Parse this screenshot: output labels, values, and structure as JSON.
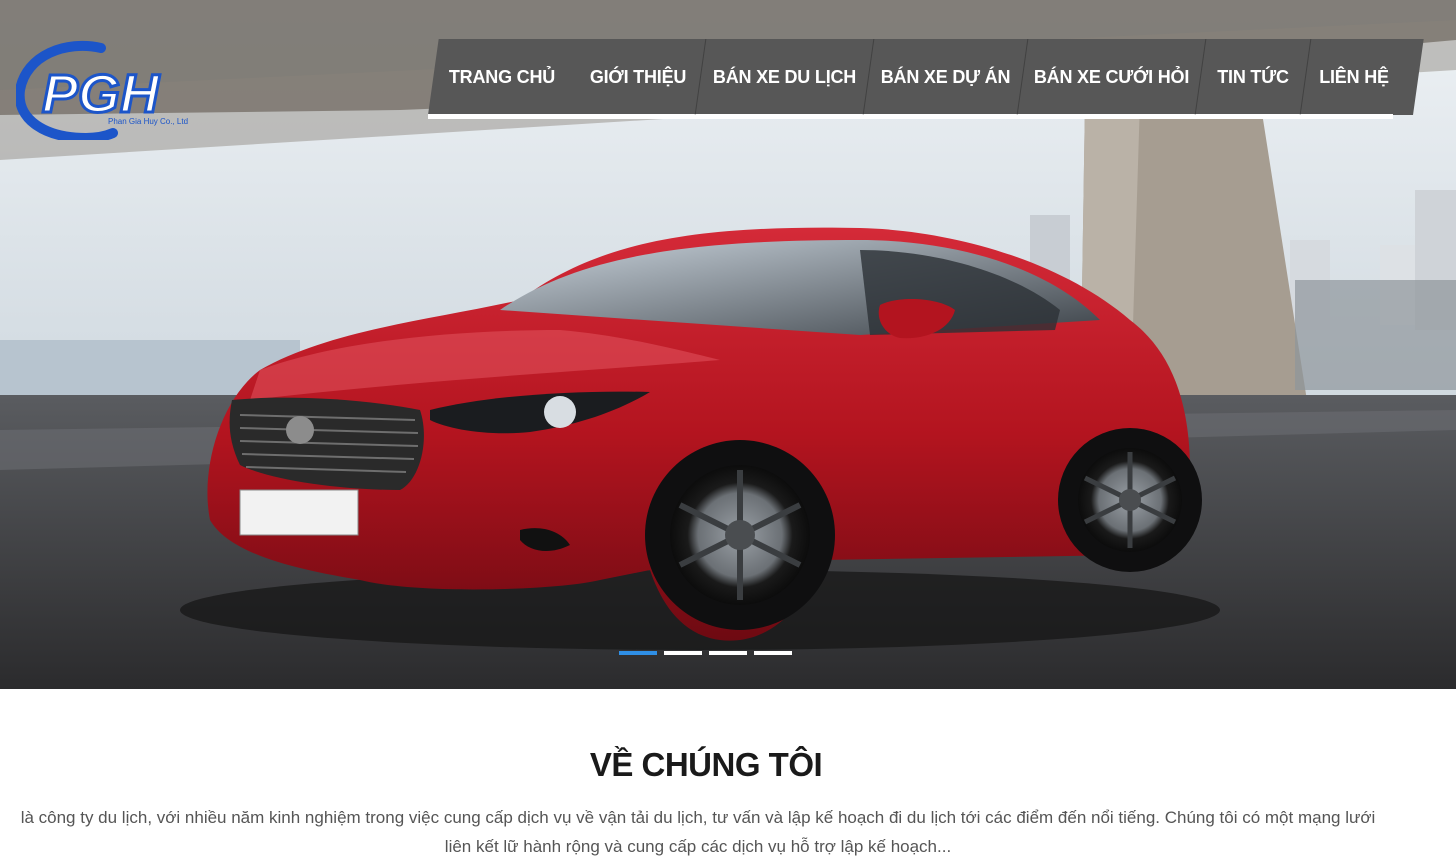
{
  "logo": {
    "text": "PGH",
    "tagline": "Phan Gia Huy Co., Ltd"
  },
  "nav": {
    "items": [
      {
        "label": "TRANG CHỦ",
        "active": true
      },
      {
        "label": "GIỚI THIỆU",
        "active": false
      },
      {
        "label": "BÁN XE DU LỊCH",
        "active": false
      },
      {
        "label": "BÁN XE DỰ ÁN",
        "active": false
      },
      {
        "label": "BÁN XE CƯỚI HỎI",
        "active": false
      },
      {
        "label": "TIN TỨC",
        "active": false
      },
      {
        "label": "LIÊN HỆ",
        "active": false
      }
    ]
  },
  "slider": {
    "slide_count": 4,
    "active_index": 0
  },
  "about": {
    "title": "VỀ CHÚNG TÔI",
    "text": "là công ty du lịch, với nhiều năm kinh nghiệm trong việc cung cấp dịch vụ về vận tải du lịch, tư vấn và lập kế hoạch đi du lịch tới các điểm đến nổi tiếng. Chúng tôi có một mạng lưới liên kết lữ hành rộng và cung cấp các dịch vụ hỗ trợ lập kế hoạch..."
  },
  "colors": {
    "accent": "#1e78d4",
    "nav_bg": "#575757",
    "car": "#b3141f"
  }
}
